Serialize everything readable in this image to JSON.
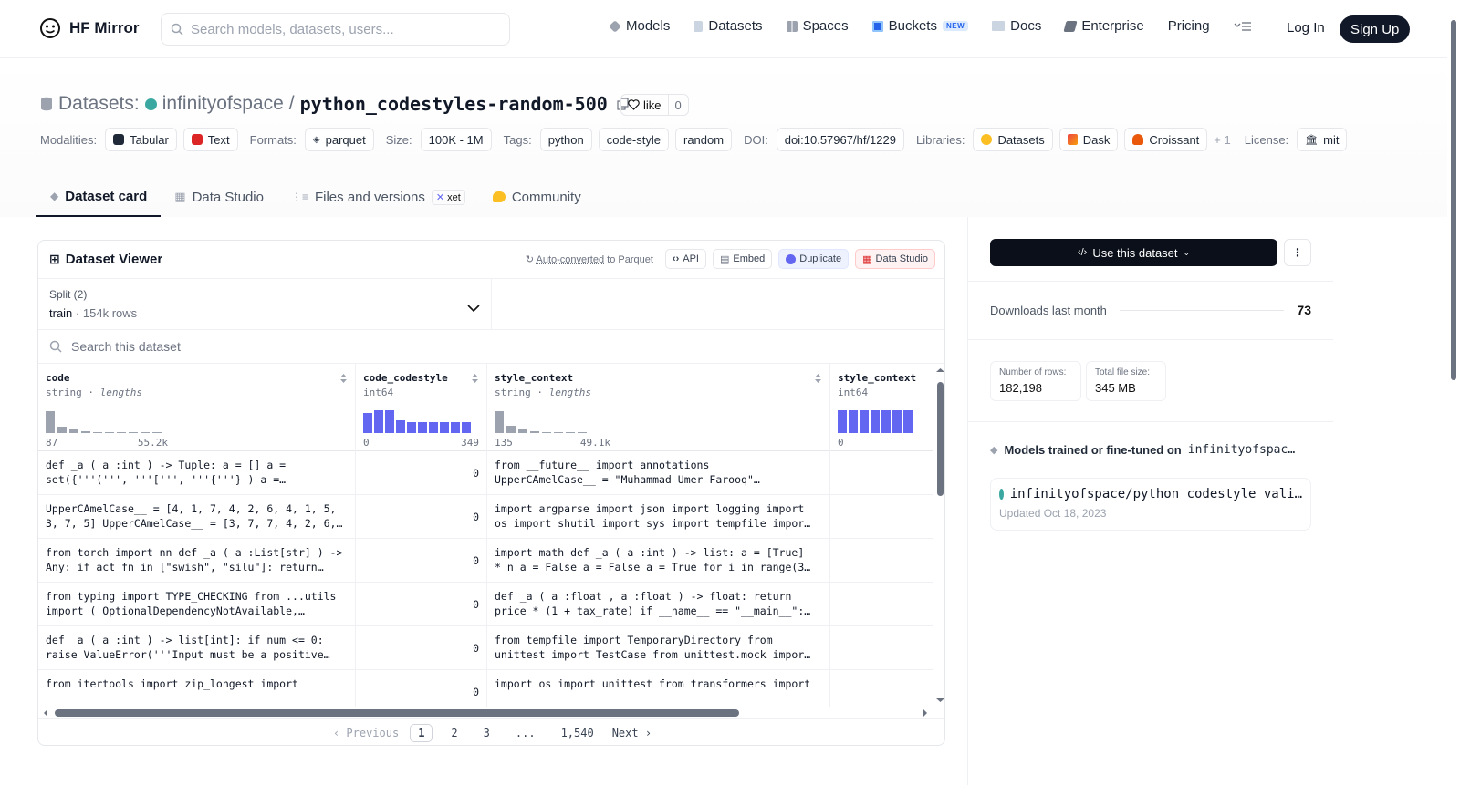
{
  "nav": {
    "brand": "HF Mirror",
    "search_placeholder": "Search models, datasets, users...",
    "links": [
      {
        "label": "Models",
        "icon": "models-icon",
        "color": "#9ca3af"
      },
      {
        "label": "Datasets",
        "icon": "datasets-icon",
        "color": "#9ca3af"
      },
      {
        "label": "Spaces",
        "icon": "spaces-icon",
        "color": "#9ca3af"
      },
      {
        "label": "Buckets",
        "icon": "buckets-icon",
        "color": "#2563eb",
        "badge": "NEW"
      },
      {
        "label": "Docs",
        "icon": "docs-icon",
        "color": "#9ca3af"
      },
      {
        "label": "Enterprise",
        "icon": "enterprise-icon",
        "color": "#6b7280"
      },
      {
        "label": "Pricing",
        "icon": "",
        "color": ""
      }
    ],
    "login": "Log In",
    "signup": "Sign Up"
  },
  "header": {
    "prefix": "Datasets:",
    "owner": "infinityofspace",
    "separator": "/",
    "name": "python_codestyles-random-500",
    "like_label": "like",
    "like_count": "0",
    "meta": {
      "modalities_label": "Modalities:",
      "modalities": [
        "Tabular",
        "Text"
      ],
      "formats_label": "Formats:",
      "format": "parquet",
      "size_label": "Size:",
      "size": "100K - 1M",
      "tags_label": "Tags:",
      "tags": [
        "python",
        "code-style",
        "random"
      ],
      "doi_label": "DOI:",
      "doi": "doi:10.57967/hf/1229",
      "libraries_label": "Libraries:",
      "libraries": [
        "Datasets",
        "Dask",
        "Croissant"
      ],
      "libraries_more": "+ 1",
      "license_label": "License:",
      "license": "mit"
    },
    "tabs": [
      {
        "label": "Dataset card",
        "active": true
      },
      {
        "label": "Data Studio",
        "active": false
      },
      {
        "label": "Files and versions",
        "active": false,
        "badge": "xet"
      },
      {
        "label": "Community",
        "active": false
      }
    ]
  },
  "viewer": {
    "title": "Dataset Viewer",
    "auto_converted": "Auto-converted",
    "to_parquet": "to Parquet",
    "api": "API",
    "embed": "Embed",
    "duplicate": "Duplicate",
    "data_studio": "Data Studio",
    "split_label": "Split (2)",
    "split_name": "train",
    "split_sep": "·",
    "split_rows": "154k rows",
    "search_placeholder": "Search this dataset",
    "columns": [
      {
        "name": "code",
        "type": "string",
        "sub": "lengths",
        "min": "87",
        "max": "55.2k"
      },
      {
        "name": "code_codestyle",
        "type": "int64",
        "sub": "",
        "min": "0",
        "max": "349"
      },
      {
        "name": "style_context",
        "type": "string",
        "sub": "lengths",
        "min": "135",
        "max": "49.1k"
      },
      {
        "name": "style_context",
        "type": "int64",
        "sub": "",
        "min": "0",
        "max": ""
      }
    ],
    "rows": [
      {
        "code": "def _a ( a :int ) -> Tuple: a = [] a =\nset({'''(''', '''[''', '''{'''} ) a =…",
        "cs": "0",
        "ctx": "from __future__ import annotations\nUpperCAmelCase__ = \"Muhammad Umer Farooq\"…"
      },
      {
        "code": "UpperCAmelCase__ = [4, 1, 7, 4, 2, 6, 4, 1, 5,\n3, 7, 5] UpperCAmelCase__ = [3, 7, 7, 4, 2, 6,…",
        "cs": "0",
        "ctx": "import argparse import json import logging import\nos import shutil import sys import tempfile impor…"
      },
      {
        "code": "from torch import nn def _a ( a :List[str] ) ->\nAny: if act_fn in [\"swish\", \"silu\"]: return…",
        "cs": "0",
        "ctx": "import math def _a ( a :int ) -> list: a = [True]\n* n a = False a = False a = True for i in range(3…"
      },
      {
        "code": "from typing import TYPE_CHECKING from ...utils\nimport ( OptionalDependencyNotAvailable,…",
        "cs": "0",
        "ctx": "def _a ( a :float , a :float ) -> float: return\nprice * (1 + tax_rate) if __name__ == \"__main__\":…"
      },
      {
        "code": "def _a ( a :int ) -> list[int]: if num <= 0:\nraise ValueError('''Input must be a positive…",
        "cs": "0",
        "ctx": "from tempfile import TemporaryDirectory from\nunittest import TestCase from unittest.mock impor…"
      },
      {
        "code": "from itertools import zip_longest import",
        "cs": "0",
        "ctx": "import os import unittest from transformers import"
      }
    ],
    "pager": {
      "prev": "Previous",
      "pages": [
        "1",
        "2",
        "3",
        "...",
        "1,540"
      ],
      "next": "Next"
    }
  },
  "sidebar": {
    "use_dataset": "Use this dataset",
    "downloads_label": "Downloads last month",
    "downloads": "73",
    "rows_label": "Number of rows:",
    "rows_value": "182,198",
    "size_label": "Total file size:",
    "size_value": "345 MB",
    "models_label": "Models trained or fine-tuned on",
    "models_owner": "infinityofspac…",
    "model_name": "infinityofspace/python_codestyle_vali…",
    "model_updated": "Updated Oct 18, 2023"
  }
}
